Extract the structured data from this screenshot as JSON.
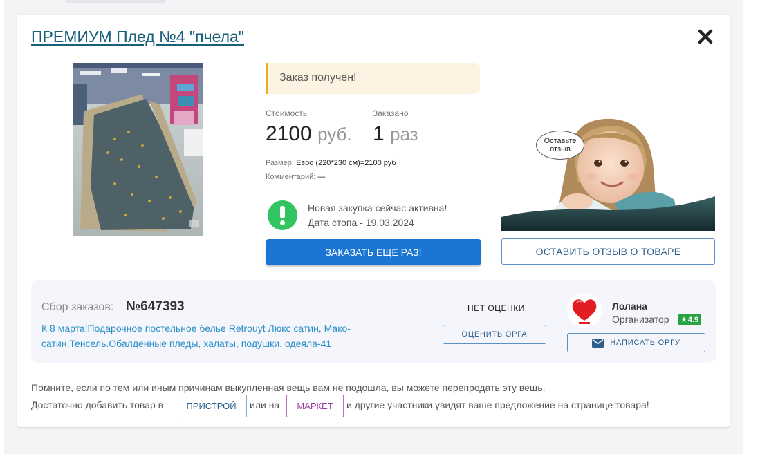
{
  "product": {
    "title": "ПРЕМИУМ Плед №4 \"пчела\""
  },
  "status": {
    "message": "Заказ получен!",
    "color": "#f0a92a"
  },
  "price": {
    "label": "Стоимость",
    "value": "2100",
    "unit": "руб."
  },
  "ordered": {
    "label": "Заказано",
    "value": "1",
    "unit": "раз"
  },
  "details": {
    "size_label": "Размер:",
    "size_value": "Евро (220*230 см)=2100 руб",
    "comment_label": "Комментарий:",
    "comment_value": "—"
  },
  "purchase": {
    "active_text": "Новая закупка сейчас активна!",
    "stop_date": "Дата стопа - 19.03.2024",
    "icon": "exclamation-icon",
    "color": "#31c460"
  },
  "buttons": {
    "order_again": "ЗАКАЗАТЬ ЕЩЕ РАЗ!",
    "leave_review": "ОСТАВИТЬ ОТЗЫВ О ТОВАРЕ",
    "rate_org": "ОЦЕНИТЬ ОРГА",
    "write_org": "НАПИСАТЬ ОРГУ",
    "pristroy": "ПРИСТРОЙ",
    "market": "МАРКЕТ"
  },
  "review_banner": {
    "bubble_text": "Оставьте отзыв"
  },
  "collection": {
    "label": "Сбор заказов:",
    "number": "№647393",
    "description": "К 8 марта!Подарочное постельное белье Retrouyt Люкс сатин, Мако-сатин,Тенсель.Обалденные пледы, халаты, подушки, одеяла-41"
  },
  "organizer": {
    "no_rating": "НЕТ ОЦЕНКИ",
    "name": "Лолана",
    "role": "Организатор",
    "rating": "4.9",
    "rating_color": "#27a344"
  },
  "footer": {
    "line1": "Помните, если по тем или иным причинам выкупленная вещь вам не подошла, вы можете перепродать эту вещь.",
    "line2_prefix": "Достаточно добавить товар в",
    "line2_middle": "или на",
    "line2_suffix": "и другие участники увидят ваше предложение на странице товара!"
  },
  "colors": {
    "primary_button": "#1b76d3",
    "title_link": "#18607a",
    "description_link": "#2b8fc7"
  }
}
